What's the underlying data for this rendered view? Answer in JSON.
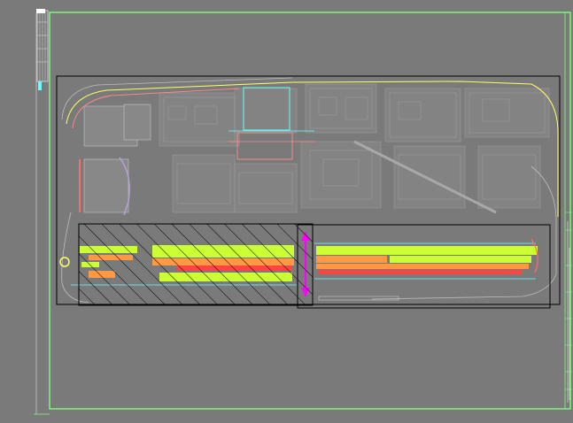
{
  "viewer": {
    "background": "#7a7a7a",
    "sheet_border_color": "#7dff7d",
    "frame_line_color": "#000000",
    "hatch_color": "#000000",
    "site_line_color": "#ffff66",
    "pink_line_color": "#ff6b6b",
    "cyan_line_color": "#66ffff",
    "magenta_marker_color": "#ff00ff",
    "fill_yellow_green": "#ccff33",
    "fill_orange": "#ff9944",
    "fill_red": "#ff4444",
    "building_gray": "#8a8a8a",
    "building_outline": "#9c9c9c"
  },
  "layers": {
    "sheet_frame": "sheet-frame",
    "title_block": "title-block-strip",
    "left_bar": "left-index-bar",
    "site_plan": "site-plan",
    "upper_viewport": "upper-viewport-frame",
    "lower_viewport": "lower-viewport-frame",
    "hatched_zone": "hatched-zone"
  }
}
